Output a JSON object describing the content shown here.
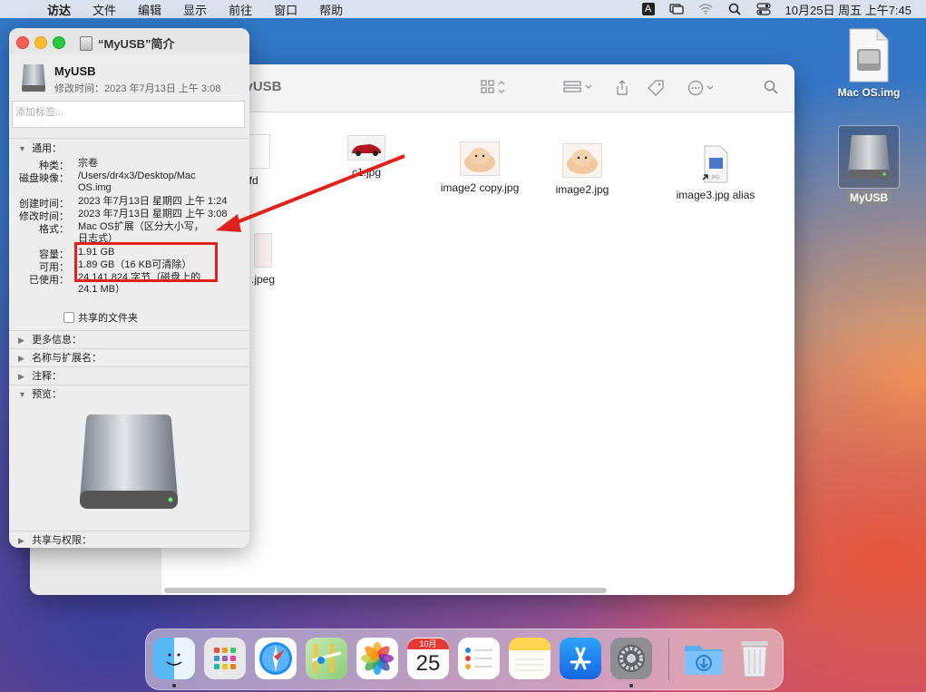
{
  "menubar": {
    "app": "访达",
    "items": [
      "文件",
      "编辑",
      "显示",
      "前往",
      "窗口",
      "帮助"
    ],
    "ime": "A",
    "clock": "10月25日 周五 上午7:45"
  },
  "desktop": {
    "icons": [
      {
        "label": "Mac OS.img"
      },
      {
        "label": "MyUSB"
      }
    ]
  },
  "finder": {
    "title": "MyUSB",
    "files": [
      {
        "name": "rtfd"
      },
      {
        "name": "c1.jpg"
      },
      {
        "name": "image2 copy.jpg"
      },
      {
        "name": "image2.jpg"
      },
      {
        "name": "image3.jpg alias"
      },
      {
        "name": ".jpeg"
      }
    ]
  },
  "info": {
    "window_title": "“MyUSB”简介",
    "name": "MyUSB",
    "modified_header": "修改时间：2023 年7月13日 上午 3:08",
    "tags_placeholder": "添加标签...",
    "general": {
      "title": "通用：",
      "rows": [
        {
          "k": "种类：",
          "v": "宗卷"
        },
        {
          "k": "磁盘映像：",
          "v": "/Users/dr4x3/Desktop/Mac OS.img"
        },
        {
          "k": "创建时间：",
          "v": "2023 年7月13日 星期四 上午 1:24"
        },
        {
          "k": "修改时间：",
          "v": "2023 年7月13日 星期四 上午 3:08"
        },
        {
          "k": "格式：",
          "v": "Mac OS扩展（区分大小写，日志式）"
        },
        {
          "k": "容量：",
          "v": "1.91 GB"
        },
        {
          "k": "可用：",
          "v": "1.89 GB（16 KB可清除）"
        },
        {
          "k": "已使用：",
          "v": "24,141,824 字节（磁盘上的24.1 MB）"
        }
      ],
      "shared_folder": "共享的文件夹"
    },
    "sections": {
      "more_info": "更多信息：",
      "name_ext": "名称与扩展名：",
      "comments": "注释：",
      "preview": "预览：",
      "sharing": "共享与权限："
    }
  },
  "dock": {
    "calendar_month": "10月",
    "calendar_day": "25"
  },
  "colors": {
    "accent": "#1a73e8",
    "annotation_red": "#e0211b"
  }
}
